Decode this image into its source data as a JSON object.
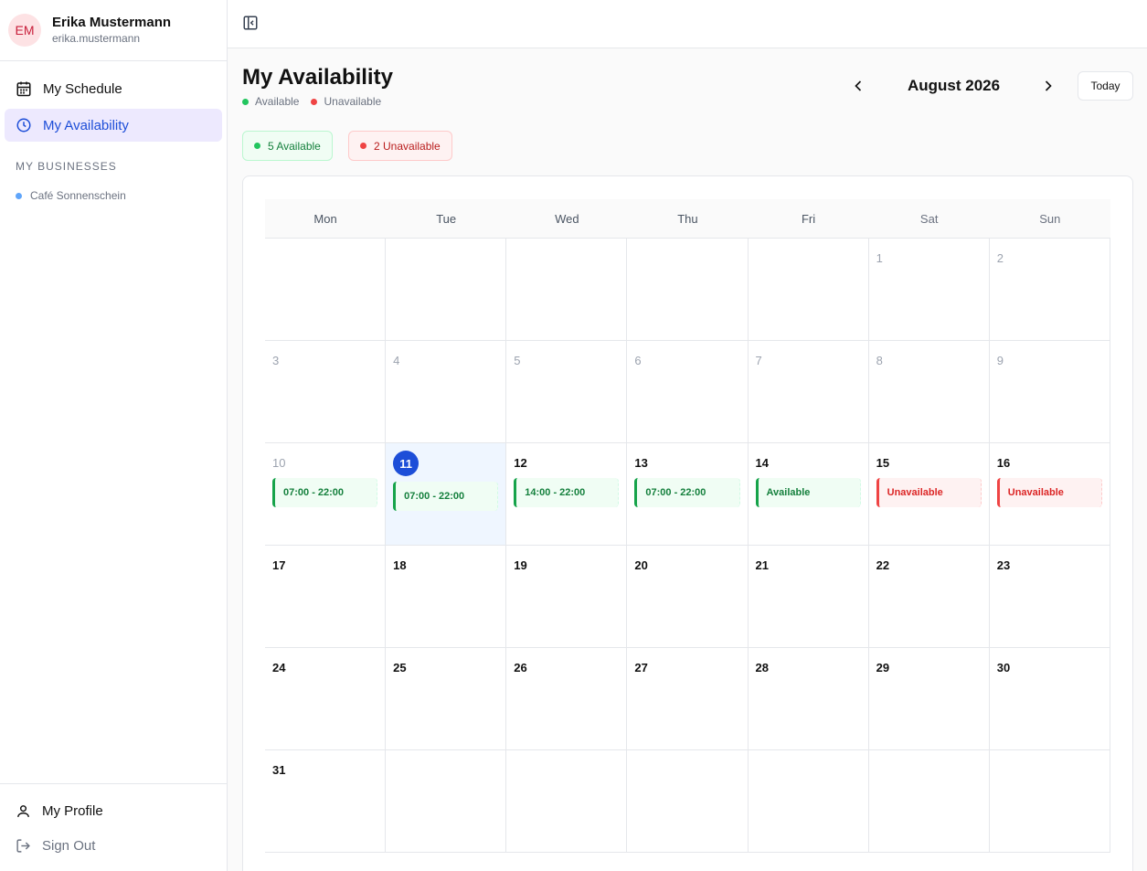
{
  "user": {
    "initials": "EM",
    "name": "Erika Mustermann",
    "email": "erika.mustermann"
  },
  "nav": {
    "schedule": "My Schedule",
    "availability": "My Availability"
  },
  "businesses": {
    "label": "MY BUSINESSES",
    "items": [
      "Café Sonnenschein"
    ]
  },
  "bottom": {
    "profile": "My Profile",
    "signout": "Sign Out"
  },
  "page": {
    "title": "My Availability",
    "legend_available": "Available",
    "legend_unavailable": "Unavailable",
    "month": "August 2026",
    "today_button": "Today",
    "badge_available": "5 Available",
    "badge_unavailable": "2 Unavailable"
  },
  "colors": {
    "available": "#22c55e",
    "unavailable": "#ef4444",
    "accent": "#1d4ed8"
  },
  "calendar": {
    "weekdays": [
      "Mon",
      "Tue",
      "Wed",
      "Thu",
      "Fri",
      "Sat",
      "Sun"
    ],
    "cells": [
      {
        "day": ""
      },
      {
        "day": ""
      },
      {
        "day": ""
      },
      {
        "day": ""
      },
      {
        "day": ""
      },
      {
        "day": "1",
        "past": true
      },
      {
        "day": "2",
        "past": true
      },
      {
        "day": "3",
        "past": true
      },
      {
        "day": "4",
        "past": true
      },
      {
        "day": "5",
        "past": true
      },
      {
        "day": "6",
        "past": true
      },
      {
        "day": "7",
        "past": true
      },
      {
        "day": "8",
        "past": true
      },
      {
        "day": "9",
        "past": true
      },
      {
        "day": "10",
        "past": true,
        "chip": "07:00 - 22:00",
        "status": "green"
      },
      {
        "day": "11",
        "today": true,
        "chip": "07:00 - 22:00",
        "status": "green"
      },
      {
        "day": "12",
        "chip": "14:00 - 22:00",
        "status": "green"
      },
      {
        "day": "13",
        "chip": "07:00 - 22:00",
        "status": "green"
      },
      {
        "day": "14",
        "chip": "Available",
        "status": "green"
      },
      {
        "day": "15",
        "chip": "Unavailable",
        "status": "red"
      },
      {
        "day": "16",
        "chip": "Unavailable",
        "status": "red"
      },
      {
        "day": "17"
      },
      {
        "day": "18"
      },
      {
        "day": "19"
      },
      {
        "day": "20"
      },
      {
        "day": "21"
      },
      {
        "day": "22"
      },
      {
        "day": "23"
      },
      {
        "day": "24"
      },
      {
        "day": "25"
      },
      {
        "day": "26"
      },
      {
        "day": "27"
      },
      {
        "day": "28"
      },
      {
        "day": "29"
      },
      {
        "day": "30"
      },
      {
        "day": "31"
      },
      {
        "day": ""
      },
      {
        "day": ""
      },
      {
        "day": ""
      },
      {
        "day": ""
      },
      {
        "day": ""
      },
      {
        "day": ""
      }
    ]
  }
}
